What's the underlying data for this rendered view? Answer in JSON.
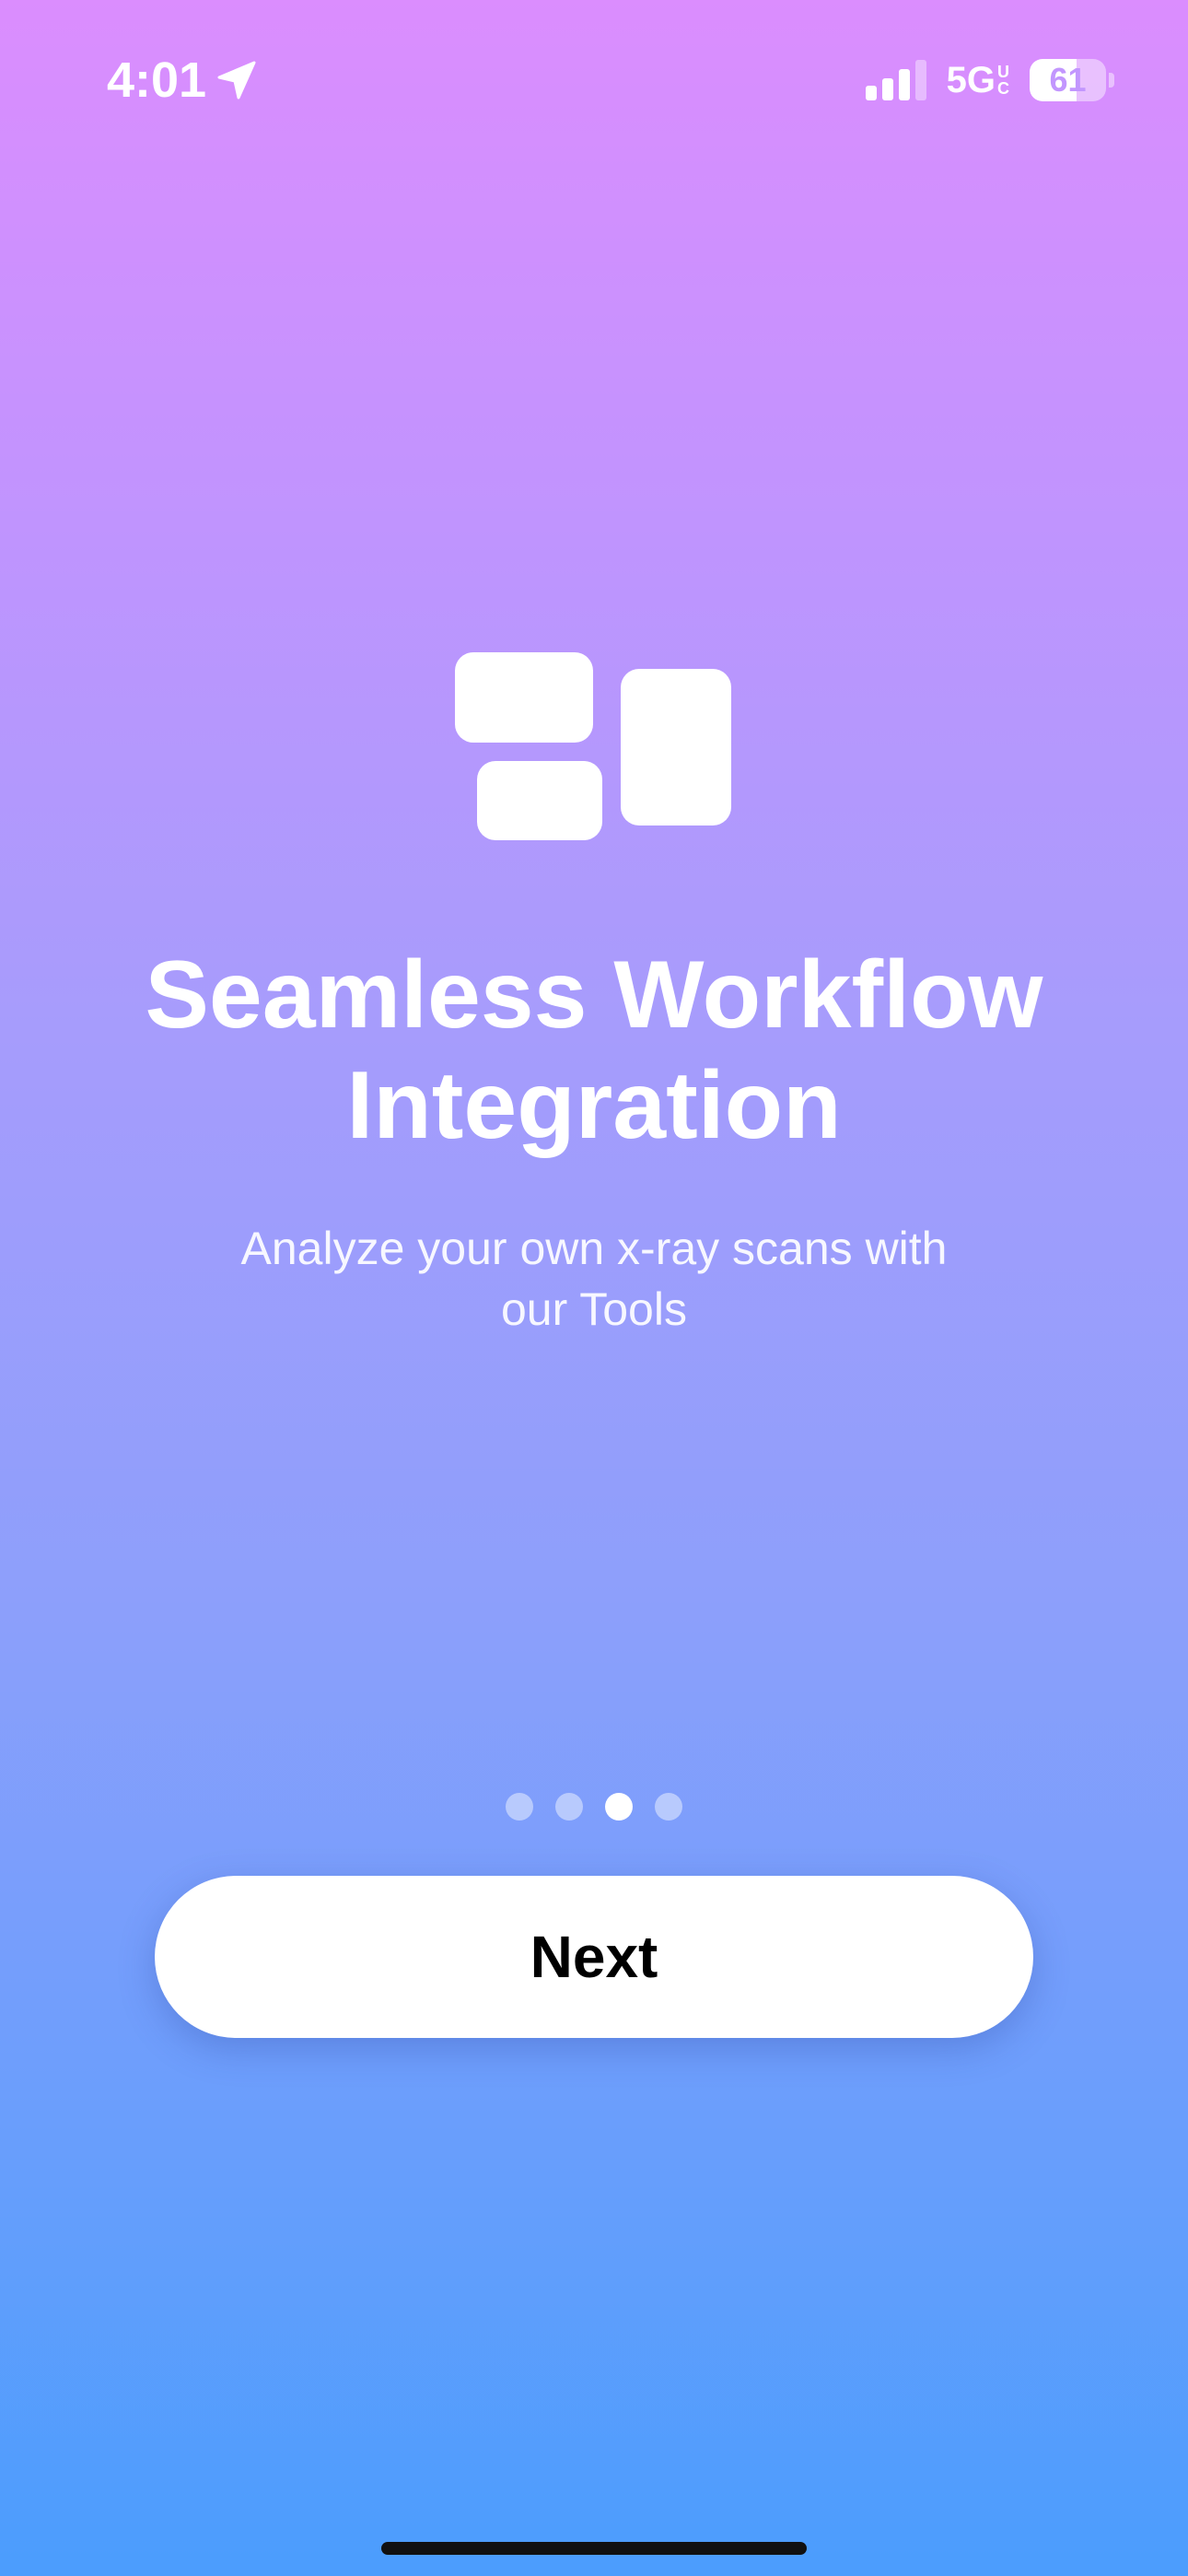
{
  "status_bar": {
    "time": "4:01",
    "location_icon": "location-arrow-icon",
    "signal_icon": "cellular-signal-icon",
    "signal_bars_active": 3,
    "signal_bars_total": 4,
    "network": "5G",
    "network_sup_top": "U",
    "network_sup_bottom": "C",
    "battery_level": "61",
    "battery_fraction": 0.61
  },
  "onboarding": {
    "icon": "workflow-blocks-icon",
    "title_line1": "Seamless Workflow",
    "title_line2": "Integration",
    "subtitle_line1": "Analyze your own x-ray scans with",
    "subtitle_line2": "our Tools",
    "page_count": 4,
    "current_page_index": 2
  },
  "actions": {
    "next_label": "Next"
  },
  "colors": {
    "gradient_top": "#DB8DFE",
    "gradient_bottom": "#4B9DFD",
    "button_bg": "#FFFFFF",
    "button_text": "#000000"
  }
}
